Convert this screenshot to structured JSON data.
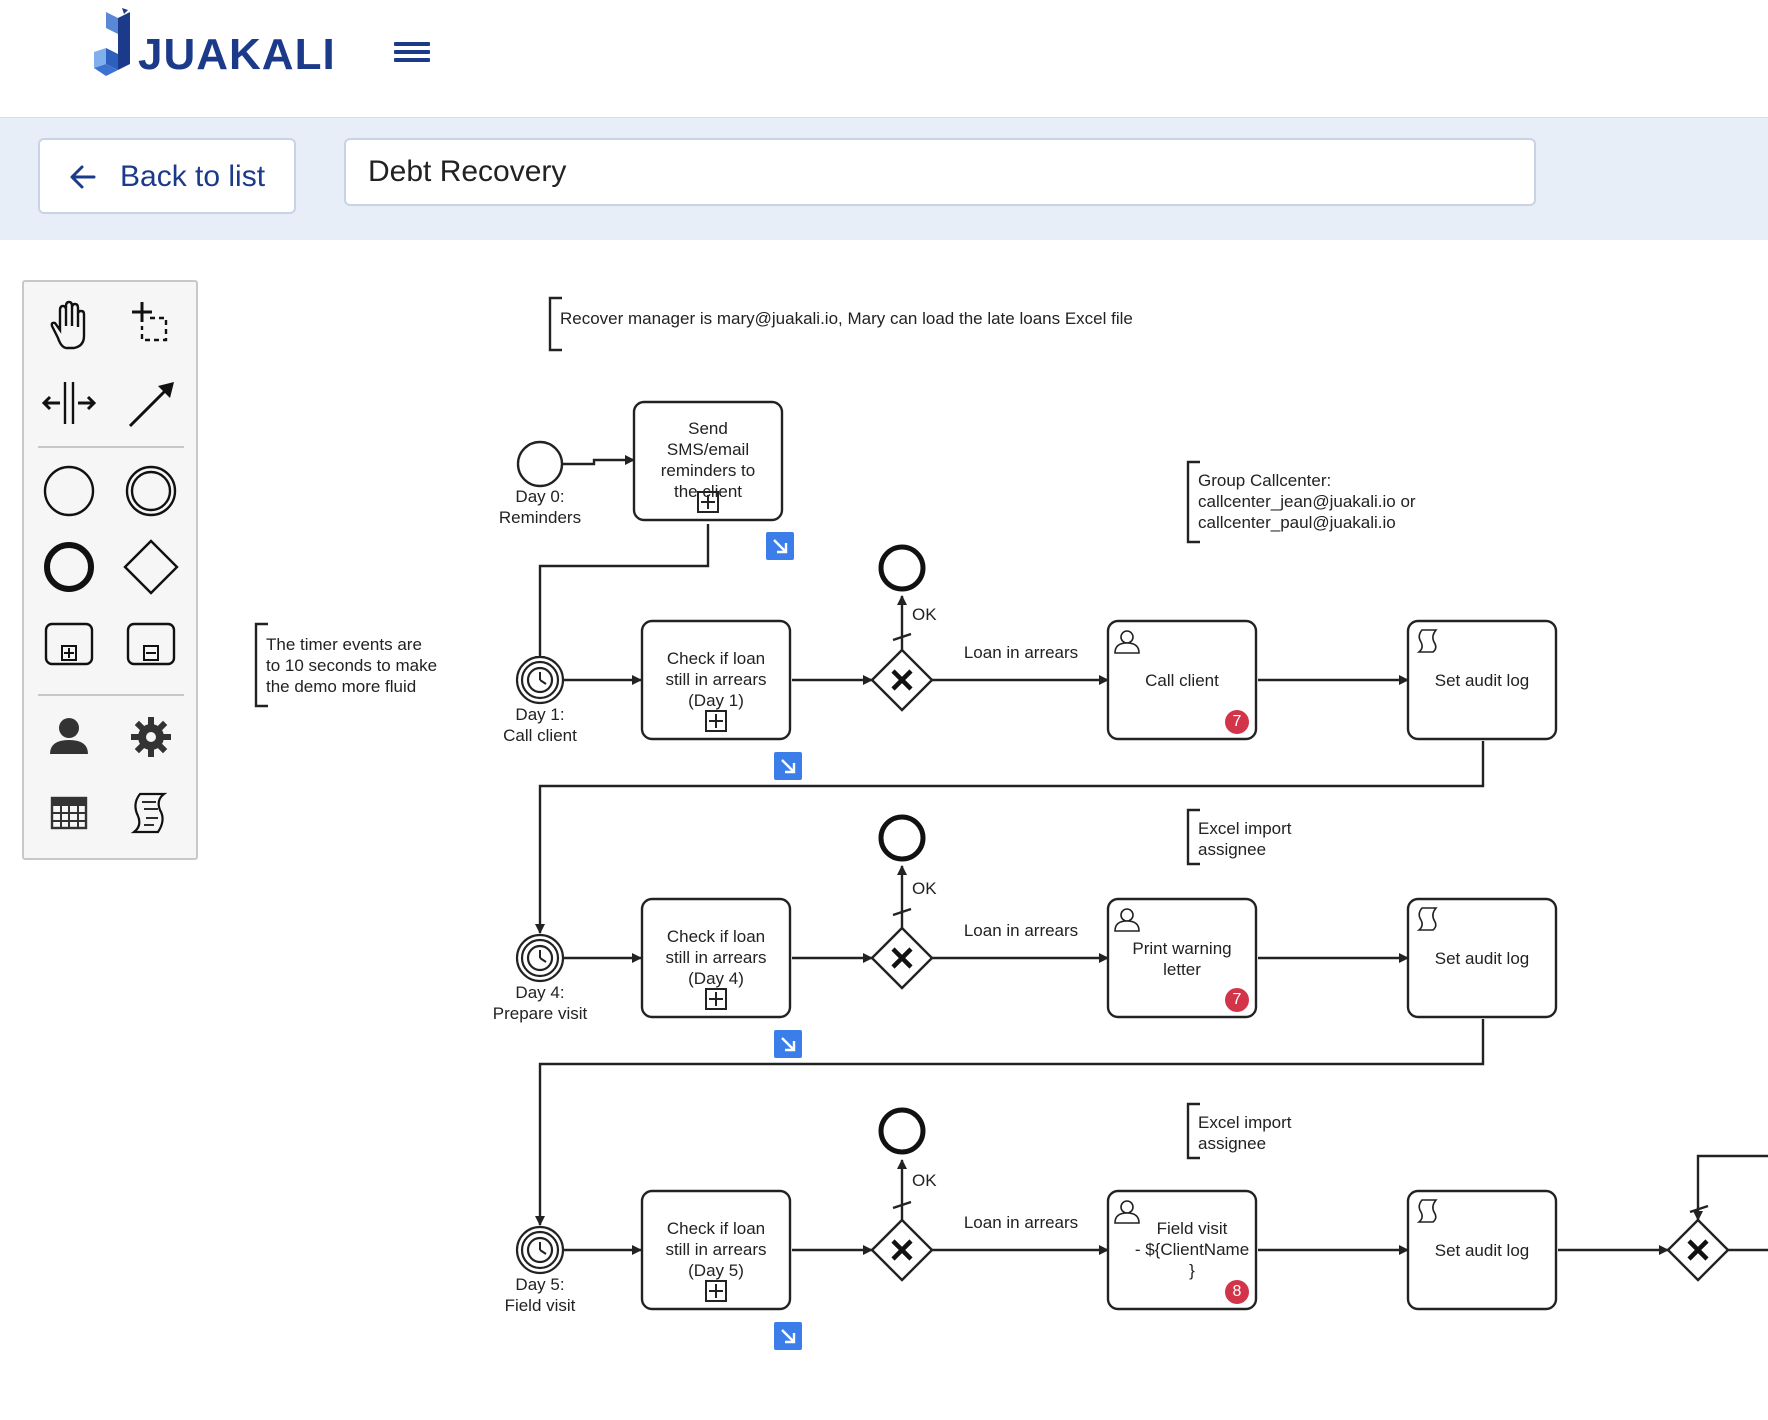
{
  "header": {
    "logo_text": "JUAKALI",
    "menu_icon": "hamburger-icon",
    "back_label": "Back to list",
    "process_name": "Debt Recovery"
  },
  "palette": {
    "tools": [
      "hand-tool-icon",
      "lasso-tool-icon",
      "space-tool-icon",
      "connect-tool-icon",
      "start-event-icon",
      "intermediate-event-icon",
      "end-event-icon",
      "gateway-icon",
      "expanded-subprocess-icon",
      "collapsed-subprocess-icon",
      "user-task-icon",
      "service-task-icon",
      "data-table-icon",
      "script-task-icon"
    ]
  },
  "diagram": {
    "annotations": {
      "manager": "Recover manager is mary@juakali.io, Mary can load the late loans Excel file",
      "callcenter": "Group Callcenter:\ncallcenter_jean@juakali.io or\ncallcenter_paul@juakali.io",
      "timer_note": "The timer events are\nto 10 seconds to make\nthe demo more fluid",
      "excel1": "Excel import\nassignee",
      "excel2": "Excel import\nassignee"
    },
    "start_label": "Day 0:\nReminders",
    "send_task": "Send\nSMS/email\nreminders to\nthe client",
    "timer1_label": "Day 1:\nCall client",
    "timer4_label": "Day 4:\nPrepare visit",
    "timer5_label": "Day 5:\nField visit",
    "check1": "Check if loan\nstill in arrears\n(Day 1)",
    "check4": "Check if loan\nstill in arrears\n(Day 4)",
    "check5": "Check if loan\nstill in arrears\n(Day 5)",
    "ok1": "OK",
    "ok2": "OK",
    "ok3": "OK",
    "arrears1": "Loan in arrears",
    "arrears2": "Loan in arrears",
    "arrears3": "Loan in arrears",
    "call_client": "Call client",
    "print_warning": "Print warning\nletter",
    "field_visit": "Field visit\n- ${ClientName\n}",
    "audit1": "Set audit log",
    "audit2": "Set audit log",
    "audit3": "Set audit log",
    "badge_call": "7",
    "badge_print": "7",
    "badge_field": "8"
  },
  "colors": {
    "brand": "#1c3a8a",
    "badge": "#d2354a",
    "more_button": "#3b7de9"
  }
}
